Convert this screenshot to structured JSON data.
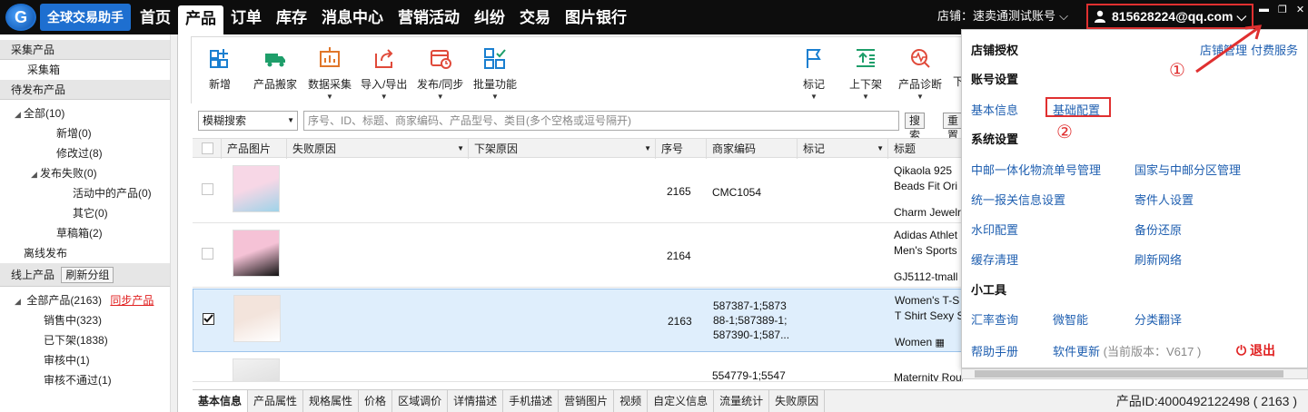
{
  "app": {
    "logo_letter": "G",
    "logo_text": "全球交易助手"
  },
  "nav": [
    "首页",
    "产品",
    "订单",
    "库存",
    "消息中心",
    "营销活动",
    "纠纷",
    "交易",
    "图片银行"
  ],
  "store_label": "店铺：速卖通测试账号",
  "account_email": "815628224@qq.com",
  "sidebar": {
    "collect_head": "采集产品",
    "collect_box": "采集箱",
    "pending_head": "待发布产品",
    "pending": [
      {
        "label": "全部(10)",
        "indent": 0,
        "tri": "◢"
      },
      {
        "label": "新增(0)",
        "indent": 2,
        "tri": ""
      },
      {
        "label": "修改过(8)",
        "indent": 2,
        "tri": ""
      },
      {
        "label": "发布失败(0)",
        "indent": 1,
        "tri": "◢"
      },
      {
        "label": "活动中的产品(0)",
        "indent": 3,
        "tri": ""
      },
      {
        "label": "其它(0)",
        "indent": 3,
        "tri": ""
      },
      {
        "label": "草稿箱(2)",
        "indent": 2,
        "tri": ""
      },
      {
        "label": "离线发布",
        "indent": 0,
        "tri": ""
      }
    ],
    "online_head": "线上产品",
    "refresh_group": "刷新分组",
    "all_products": "全部产品(2163)",
    "sync_products": "同步产品",
    "online": [
      "销售中(323)",
      "已下架(1838)",
      "审核中(1)",
      "审核不通过(1)"
    ]
  },
  "toolbar": {
    "left": [
      "新增",
      "产品搬家",
      "数据采集",
      "导入/导出",
      "发布/同步",
      "批量功能"
    ],
    "right": [
      "标记",
      "上下架",
      "产品诊断",
      "下"
    ]
  },
  "search": {
    "mode": "模糊搜索",
    "placeholder": "序号、ID、标题、商家编码、产品型号、类目(多个空格或逗号隔开)",
    "search_btn": "搜索",
    "reset_btn": "重置"
  },
  "columns": [
    "产品图片",
    "失败原因",
    "下架原因",
    "序号",
    "商家编码",
    "标记",
    "标题"
  ],
  "rows": [
    {
      "seq": "2165",
      "code": "CMC1054",
      "title1": "Qikaola 925",
      "title2": "Beads Fit Ori",
      "title3": "Charm Jewelr",
      "selected": false
    },
    {
      "seq": "2164",
      "code": "",
      "title1": "Adidas Athlet",
      "title2": "Men's Sports",
      "title3": "GJ5112-tmall",
      "selected": false
    },
    {
      "seq": "2163",
      "code": "587387-1;5873\n88-1;587389-1;\n587390-1;587...",
      "title1": "Women's T-S",
      "title2": "T Shirt Sexy S",
      "title3": "Women",
      "selected": true
    },
    {
      "seq": "",
      "code": "554779-1;5547",
      "title1": "Maternity Round Neck T-shirt Women Printed",
      "title2": "",
      "title3": "",
      "selected": false
    }
  ],
  "bottom_tabs": [
    "基本信息",
    "产品属性",
    "规格属性",
    "价格",
    "区域调价",
    "详情描述",
    "手机描述",
    "营销图片",
    "视频",
    "自定义信息",
    "流量统计",
    "失败原因"
  ],
  "product_id_text": "产品ID:4000492122498 ( 2163 )",
  "panel": {
    "store_auth": "店铺授权",
    "store_manage": "店铺管理",
    "paid_service": "付费服务",
    "account_settings": "账号设置",
    "basic_info": "基本信息",
    "basic_config": "基础配置",
    "system_settings": "系统设置",
    "sys_links": [
      "中邮一体化物流单号管理",
      "国家与中邮分区管理",
      "统一报关信息设置",
      "寄件人设置",
      "水印配置",
      "备份还原",
      "缓存清理",
      "刷新网络"
    ],
    "tools_title": "小工具",
    "tools": [
      "汇率查询",
      "微智能",
      "分类翻译"
    ],
    "help": "帮助手册",
    "update": "软件更新",
    "version": "(当前版本：V617 )",
    "logout": "退出",
    "marker1": "①",
    "marker2": "②"
  },
  "colors": {
    "accent_red": "#e03030",
    "link_blue": "#1f5fb0",
    "nav_bg": "#0d0d0d"
  }
}
